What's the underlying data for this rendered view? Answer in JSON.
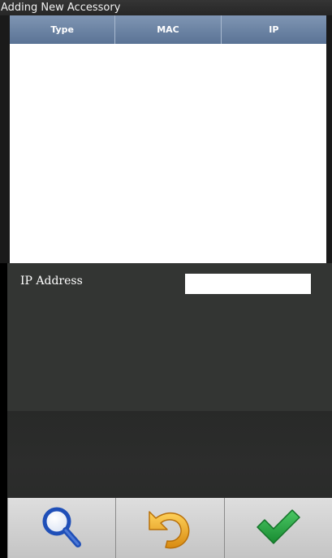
{
  "window": {
    "title": "Adding New Accessory"
  },
  "table": {
    "columns": [
      "Type",
      "MAC",
      "IP"
    ],
    "rows": []
  },
  "form": {
    "ip_label": "IP Address",
    "ip_value": ""
  },
  "toolbar": {
    "buttons": [
      {
        "icon": "search-icon",
        "color": "#1f4fb8"
      },
      {
        "icon": "undo-icon",
        "color": "#e8a21a"
      },
      {
        "icon": "checkmark-icon",
        "color": "#1e9a3a"
      }
    ]
  }
}
